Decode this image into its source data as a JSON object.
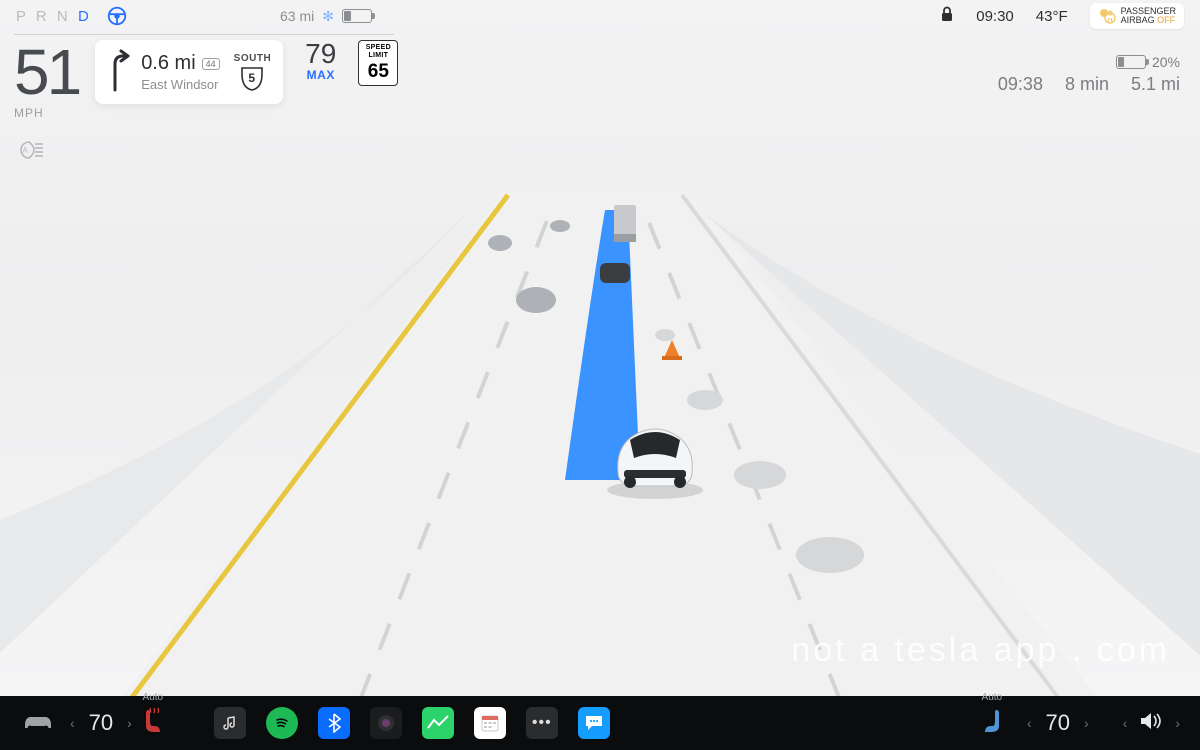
{
  "status": {
    "gears": [
      "P",
      "R",
      "N",
      "D"
    ],
    "active_gear": "D",
    "range": "63 mi",
    "clock": "09:30",
    "temp": "43°F",
    "airbag_line1": "PASSENGER",
    "airbag_line2": "AIRBAG",
    "airbag_off": "OFF"
  },
  "cluster": {
    "speed": "51",
    "speed_unit": "MPH",
    "nav_distance": "0.6 mi",
    "nav_exit": "44",
    "nav_dest": "East Windsor",
    "route_dir": "SOUTH",
    "route_num": "5",
    "set_speed": "79",
    "set_label": "MAX",
    "limit_t1": "SPEED",
    "limit_t2": "LIMIT",
    "limit_val": "65"
  },
  "trip": {
    "battery_pct": "20%",
    "eta": "09:38",
    "duration": "8 min",
    "distance": "5.1 mi"
  },
  "dock": {
    "left_temp": "70",
    "right_temp": "70",
    "auto": "Auto"
  },
  "watermark": "not a tesla app . com"
}
